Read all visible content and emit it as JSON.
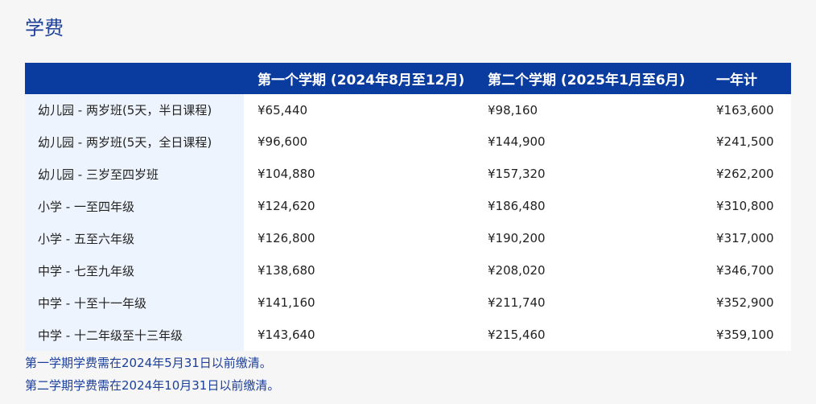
{
  "title": "学费",
  "table": {
    "headers": [
      "",
      "第一个学期 (2024年8月至12月)",
      "第二个学期 (2025年1月至6月)",
      "一年计"
    ],
    "rows": [
      {
        "level": "幼儿园 - 两岁班(5天，半日课程)",
        "term1": "¥65,440",
        "term2": "¥98,160",
        "year": "¥163,600"
      },
      {
        "level": "幼儿园 - 两岁班(5天，全日课程)",
        "term1": "¥96,600",
        "term2": "¥144,900",
        "year": "¥241,500"
      },
      {
        "level": "幼儿园 - 三岁至四岁班",
        "term1": "¥104,880",
        "term2": "¥157,320",
        "year": "¥262,200"
      },
      {
        "level": "小学 - 一至四年级",
        "term1": "¥124,620",
        "term2": "¥186,480",
        "year": "¥310,800"
      },
      {
        "level": "小学 - 五至六年级",
        "term1": "¥126,800",
        "term2": "¥190,200",
        "year": "¥317,000"
      },
      {
        "level": "中学 - 七至九年级",
        "term1": "¥138,680",
        "term2": "¥208,020",
        "year": "¥346,700"
      },
      {
        "level": "中学 - 十至十一年级",
        "term1": "¥141,160",
        "term2": "¥211,740",
        "year": "¥352,900"
      },
      {
        "level": "中学 - 十二年级至十三年级",
        "term1": "¥143,640",
        "term2": "¥215,460",
        "year": "¥359,100"
      }
    ]
  },
  "notes": [
    "第一学期学费需在2024年5月31日以前缴清。",
    "第二学期学费需在2024年10月31日以前缴清。"
  ],
  "colors": {
    "header_bg": "#0a3b9e",
    "title_text": "#1c3f9a",
    "level_column_bg": "#eef4fd"
  }
}
